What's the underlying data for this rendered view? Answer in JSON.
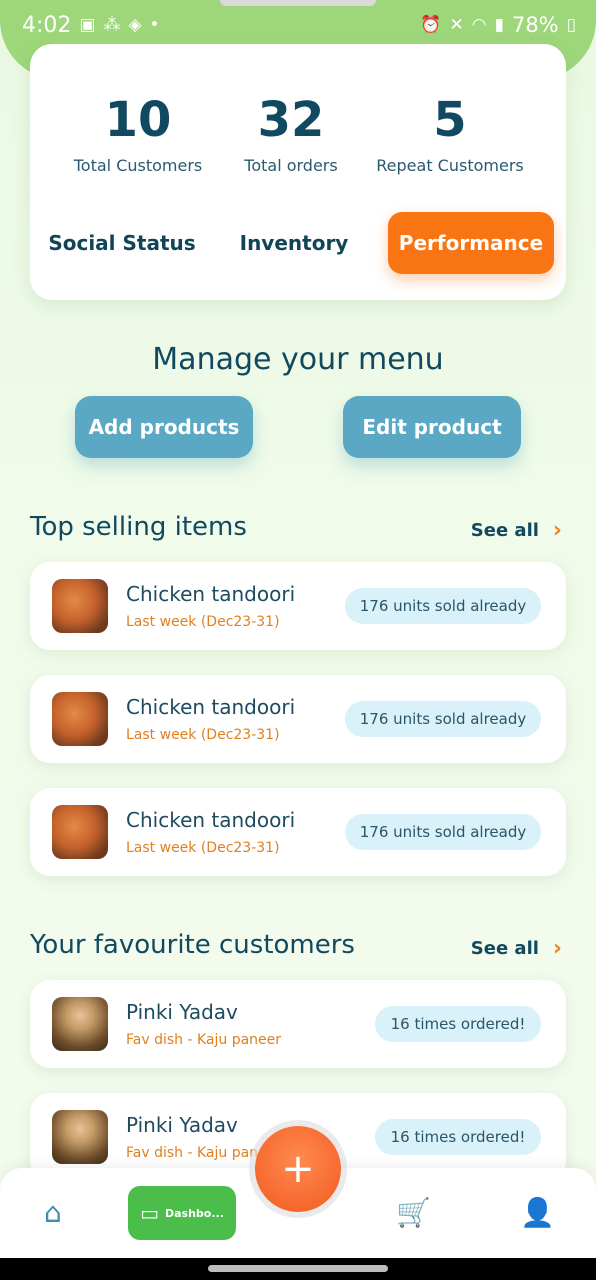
{
  "status_bar": {
    "time": "4:02",
    "battery": "78%"
  },
  "stats": [
    {
      "value": "10",
      "label": "Total Customers"
    },
    {
      "value": "32",
      "label": "Total orders"
    },
    {
      "value": "5",
      "label": "Repeat Customers"
    }
  ],
  "tabs": [
    {
      "label": "Social Status",
      "active": false
    },
    {
      "label": "Inventory",
      "active": false
    },
    {
      "label": "Performance",
      "active": true
    }
  ],
  "menu": {
    "heading": "Manage your menu",
    "add_label": "Add products",
    "edit_label": "Edit product"
  },
  "top_selling": {
    "heading": "Top selling items",
    "see_all": "See all",
    "items": [
      {
        "name": "Chicken tandoori",
        "period": "Last week (Dec23-31)",
        "badge": "176 units sold already"
      },
      {
        "name": "Chicken tandoori",
        "period": "Last week (Dec23-31)",
        "badge": "176 units sold already"
      },
      {
        "name": "Chicken tandoori",
        "period": "Last week (Dec23-31)",
        "badge": "176 units sold already"
      }
    ]
  },
  "favourite_customers": {
    "heading": "Your favourite customers",
    "see_all": "See all",
    "items": [
      {
        "name": "Pinki Yadav",
        "fav": "Fav dish - Kaju paneer",
        "badge": "16 times ordered!"
      },
      {
        "name": "Pinki Yadav",
        "fav": "Fav dish - Kaju paneer",
        "badge": "16 times ordered!"
      }
    ]
  },
  "bottom_nav": {
    "dashboard_label": "Dashbo...",
    "fab_symbol": "+"
  },
  "colors": {
    "accent_orange": "#f97412",
    "primary_blue": "#5aa8c4",
    "dashboard_green": "#4bbd4b",
    "text_dark": "#114a60",
    "sub_orange": "#e0801e"
  }
}
